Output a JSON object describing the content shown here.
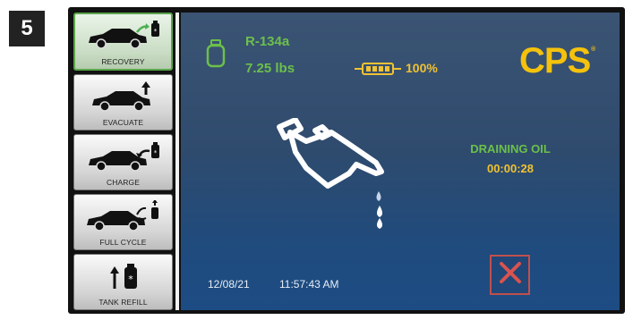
{
  "step_number": "5",
  "sidebar": {
    "items": [
      {
        "label": "RECOVERY",
        "icon": "car-recovery-icon",
        "active": true
      },
      {
        "label": "EVACUATE",
        "icon": "car-evacuate-icon",
        "active": false
      },
      {
        "label": "CHARGE",
        "icon": "car-charge-icon",
        "active": false
      },
      {
        "label": "FULL CYCLE",
        "icon": "car-full-cycle-icon",
        "active": false
      },
      {
        "label": "TANK REFILL",
        "icon": "tank-refill-icon",
        "active": false
      }
    ]
  },
  "header": {
    "refrigerant": "R-134a",
    "weight": "7.25 lbs",
    "battery_level": "100%",
    "logo": "CPS"
  },
  "main": {
    "status": "DRAINING OIL",
    "timer": "00:00:28"
  },
  "footer": {
    "date": "12/08/21",
    "time": "11:57:43 AM"
  },
  "colors": {
    "status_green": "#6cc04a",
    "accent_yellow": "#f1c232",
    "logo_yellow": "#f4c20d",
    "cancel_red": "#c0504d",
    "screen_blue": "#2f4b6d"
  }
}
